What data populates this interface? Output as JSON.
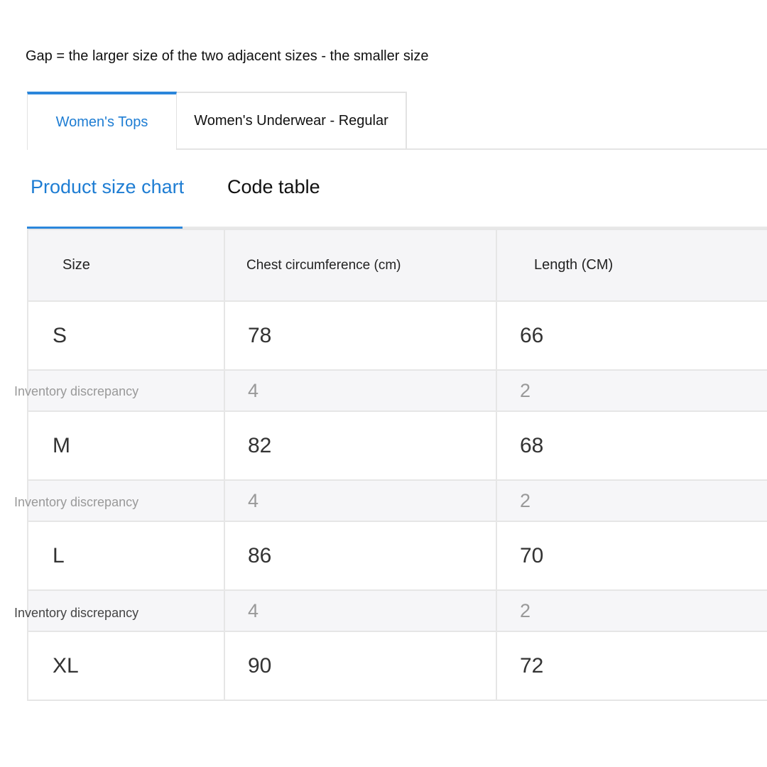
{
  "note": "Gap = the larger size of the two adjacent sizes - the smaller size",
  "category_tabs": [
    {
      "label": "Women's Tops",
      "active": true
    },
    {
      "label": "Women's Underwear - Regular",
      "active": false
    }
  ],
  "sub_tabs": [
    {
      "label": "Product size chart",
      "active": true
    },
    {
      "label": "Code table",
      "active": false
    }
  ],
  "table": {
    "headers": [
      "Size",
      "Chest circumference (cm)",
      "Length (CM)"
    ],
    "rows": [
      {
        "type": "size",
        "cells": [
          "S",
          "78",
          "66"
        ]
      },
      {
        "type": "gap",
        "label": "Inventory discrepancy",
        "cells": [
          "",
          "4",
          "2"
        ]
      },
      {
        "type": "size",
        "cells": [
          "M",
          "82",
          "68"
        ]
      },
      {
        "type": "gap",
        "label": "Inventory discrepancy",
        "cells": [
          "",
          "4",
          "2"
        ]
      },
      {
        "type": "size",
        "cells": [
          "L",
          "86",
          "70"
        ]
      },
      {
        "type": "gap",
        "label": "Inventory discrepancy",
        "cells": [
          "",
          "4",
          "2"
        ]
      },
      {
        "type": "size",
        "cells": [
          "XL",
          "90",
          "72"
        ]
      }
    ]
  },
  "colors": {
    "accent": "#1e7dd3",
    "header_bg": "#f5f5f7",
    "gap_row_bg": "#f6f6f8",
    "border": "#e6e6e6"
  }
}
